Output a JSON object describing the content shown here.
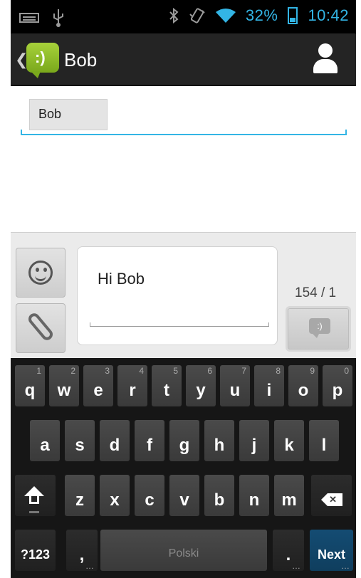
{
  "status_bar": {
    "battery": "32%",
    "time": "10:42",
    "icons": [
      "keyboard-icon",
      "usb-icon",
      "bluetooth-icon",
      "vibrate-icon",
      "wifi-icon",
      "battery-icon"
    ]
  },
  "action_bar": {
    "title": "Bob",
    "icons": [
      "back-chevron-icon",
      "messaging-app-icon",
      "contact-icon"
    ]
  },
  "recipient": {
    "chip": "Bob"
  },
  "compose": {
    "message": "Hi Bob",
    "counter": "154 / 1"
  },
  "keyboard": {
    "row1": [
      {
        "key": "q",
        "hint": "1"
      },
      {
        "key": "w",
        "hint": "2"
      },
      {
        "key": "e",
        "hint": "3"
      },
      {
        "key": "r",
        "hint": "4"
      },
      {
        "key": "t",
        "hint": "5"
      },
      {
        "key": "y",
        "hint": "6"
      },
      {
        "key": "u",
        "hint": "7"
      },
      {
        "key": "i",
        "hint": "8"
      },
      {
        "key": "o",
        "hint": "9"
      },
      {
        "key": "p",
        "hint": "0"
      }
    ],
    "row2": [
      "a",
      "s",
      "d",
      "f",
      "g",
      "h",
      "j",
      "k",
      "l"
    ],
    "row3": [
      "z",
      "x",
      "c",
      "v",
      "b",
      "n",
      "m"
    ],
    "symbols": "?123",
    "comma": ",",
    "space": "Polski",
    "period": ".",
    "next": "Next",
    "more_hint": "…"
  },
  "colors": {
    "accent": "#33b5e5",
    "action_bar": "#242424",
    "keyboard": "#161616",
    "key": "#424242",
    "next_key": "#144c73",
    "app_icon": "#8dbf25"
  }
}
